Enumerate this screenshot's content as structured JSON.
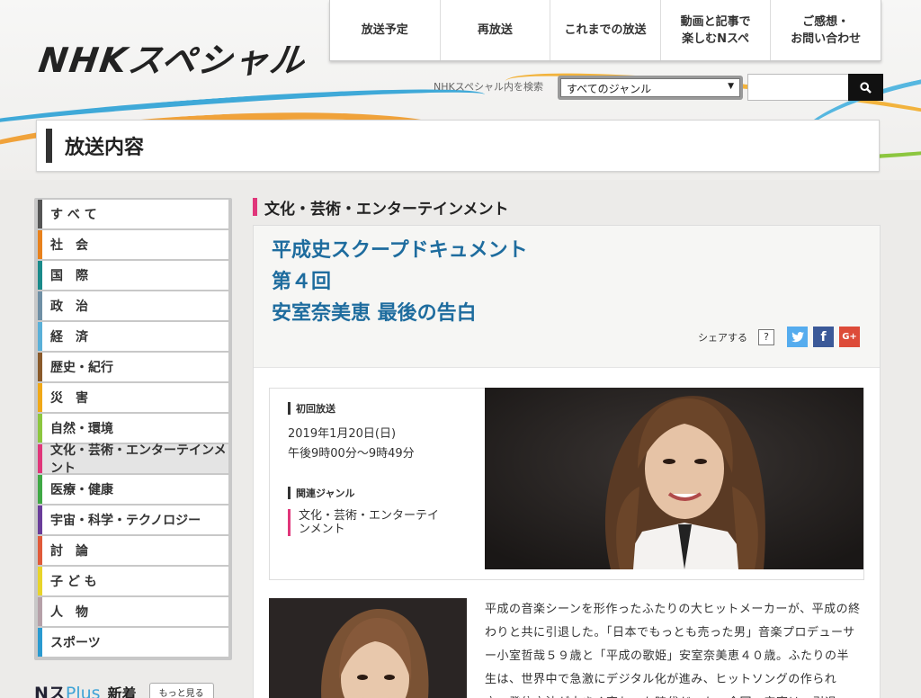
{
  "logo": {
    "text": "NHKスペシャル"
  },
  "nav": [
    {
      "label": "放送予定"
    },
    {
      "label": "再放送"
    },
    {
      "label": "これまでの放送"
    },
    {
      "label": "動画と記事で\n楽しむNスペ"
    },
    {
      "label": "ご感想・\nお問い合わせ"
    }
  ],
  "search": {
    "label": "NHKスペシャル内を検索",
    "genre_selected": "すべてのジャンル",
    "input_value": "",
    "button_icon": "search-icon"
  },
  "page_title": "放送内容",
  "sidebar": {
    "items": [
      {
        "label": "す べ て",
        "color": "#555555"
      },
      {
        "label": "社　会",
        "color": "#e8811d"
      },
      {
        "label": "国　際",
        "color": "#1a8a8a"
      },
      {
        "label": "政　治",
        "color": "#6f8fa5"
      },
      {
        "label": "経　済",
        "color": "#5ab0d8"
      },
      {
        "label": "歴史・紀行",
        "color": "#8a5a2b"
      },
      {
        "label": "災　害",
        "color": "#f0a818"
      },
      {
        "label": "自然・環境",
        "color": "#8cc63f"
      },
      {
        "label": "文化・芸術・エンターテインメント",
        "color": "#e0367a"
      },
      {
        "label": "医療・健康",
        "color": "#3fa845"
      },
      {
        "label": "宇宙・科学・テクノロジー",
        "color": "#6a3d9a"
      },
      {
        "label": "討　論",
        "color": "#e05a3a"
      },
      {
        "label": "子 ど も",
        "color": "#e8d42a"
      },
      {
        "label": "人　物",
        "color": "#b5a0a8"
      },
      {
        "label": "スポーツ",
        "color": "#2a9ad0"
      }
    ],
    "active_index": 8
  },
  "nplus": {
    "brand_n": "Nス",
    "brand_plus": "Plus",
    "new_label": "新着",
    "more_label": "もっと見る"
  },
  "category_heading": "文化・芸術・エンターテインメント",
  "program": {
    "title_line1": "平成史スクープドキュメント",
    "title_line2": "第４回",
    "title_line3": "安室奈美恵 最後の告白"
  },
  "share": {
    "label": "シェアする",
    "help": "?",
    "twitter_color": "#55acee",
    "facebook_color": "#3b5998",
    "google_color": "#dd4b39"
  },
  "broadcast": {
    "first_label": "初回放送",
    "date": "2019年1月20日(日)",
    "time": "午後9時00分～9時49分",
    "genre_label": "関連ジャンル",
    "genre_value": "文化・芸術・エンターテイ\nンメント"
  },
  "description": "平成の音楽シーンを形作ったふたりの大ヒットメーカーが、平成の終わりと共に引退した。「日本でもっとも売った男」音楽プロデューサー小室哲哉５９歳と「平成の歌姫」安室奈美恵４０歳。ふたりの半生は、世界中で急激にデジタル化が進み、ヒットソングの作られ方、発信方法が大きく変わった時代だった。今回、安室は、引退"
}
